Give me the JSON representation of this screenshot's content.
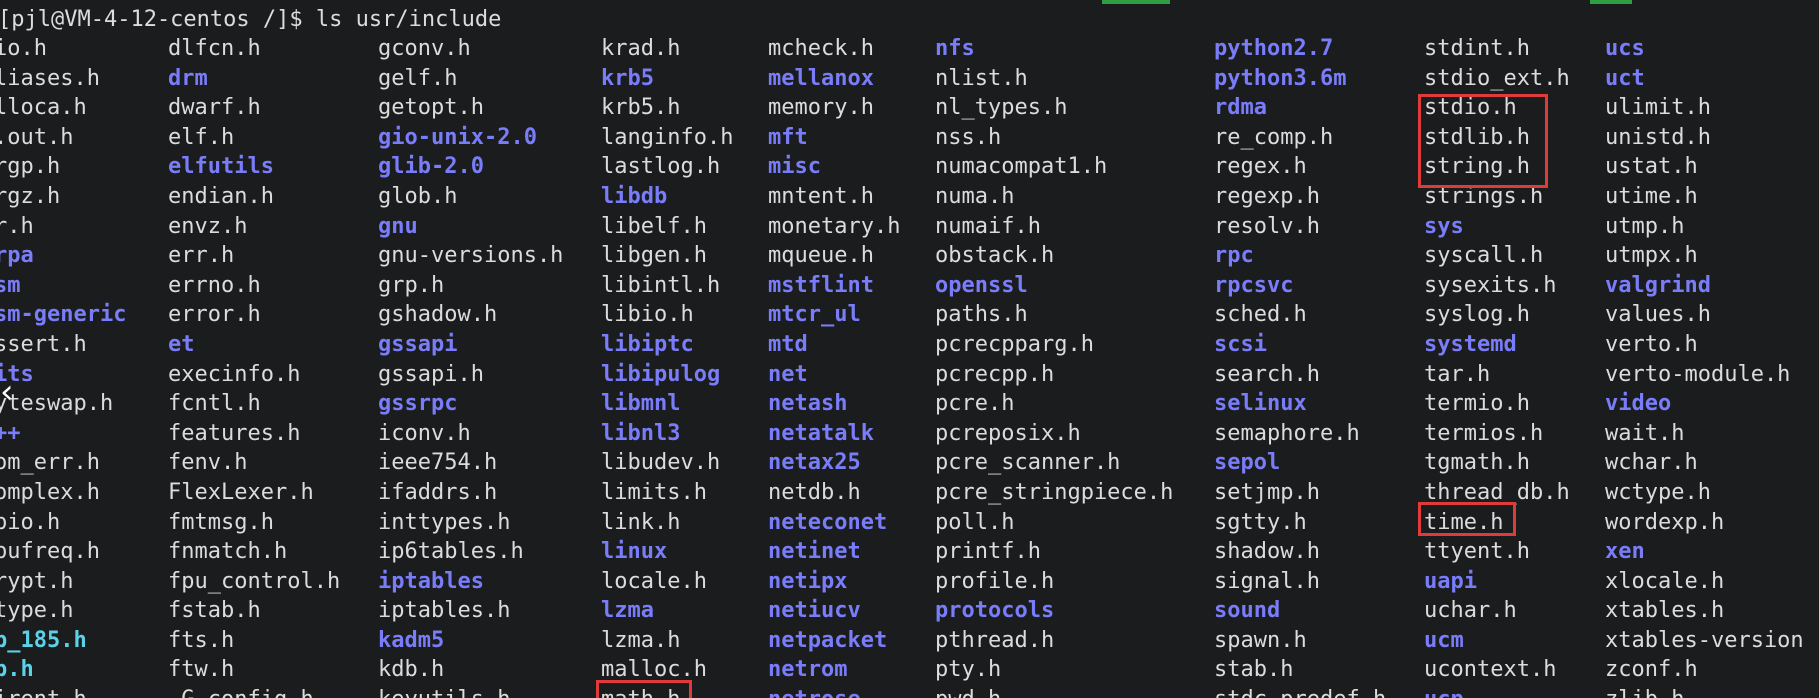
{
  "prompt": "[pjl@VM-4-12-centos /]$ ls usr/include",
  "nav_icon": "chevron-left-icon",
  "highlight_color": "#e03b3b",
  "columns": [
    {
      "entries": [
        {
          "name": "io.h",
          "type": "file"
        },
        {
          "name": "liases.h",
          "type": "file"
        },
        {
          "name": "lloca.h",
          "type": "file"
        },
        {
          "name": ".out.h",
          "type": "file"
        },
        {
          "name": "rgp.h",
          "type": "file"
        },
        {
          "name": "rgz.h",
          "type": "file"
        },
        {
          "name": "r.h",
          "type": "file"
        },
        {
          "name": "rpa",
          "type": "dir"
        },
        {
          "name": "sm",
          "type": "dir"
        },
        {
          "name": "sm-generic",
          "type": "dir"
        },
        {
          "name": "ssert.h",
          "type": "file"
        },
        {
          "name": "its",
          "type": "dir"
        },
        {
          "name": "yteswap.h",
          "type": "file"
        },
        {
          "name": "++",
          "type": "dir"
        },
        {
          "name": "om_err.h",
          "type": "file"
        },
        {
          "name": "omplex.h",
          "type": "file"
        },
        {
          "name": "pio.h",
          "type": "file"
        },
        {
          "name": "pufreq.h",
          "type": "file"
        },
        {
          "name": "rypt.h",
          "type": "file"
        },
        {
          "name": "type.h",
          "type": "file"
        },
        {
          "name": "b_185.h",
          "type": "hl"
        },
        {
          "name": "b.h",
          "type": "hl"
        },
        {
          "name": "irent.h",
          "type": "file"
        }
      ]
    },
    {
      "entries": [
        {
          "name": "dlfcn.h",
          "type": "file"
        },
        {
          "name": "drm",
          "type": "dir"
        },
        {
          "name": "dwarf.h",
          "type": "file"
        },
        {
          "name": "elf.h",
          "type": "file"
        },
        {
          "name": "elfutils",
          "type": "dir"
        },
        {
          "name": "endian.h",
          "type": "file"
        },
        {
          "name": "envz.h",
          "type": "file"
        },
        {
          "name": "err.h",
          "type": "file"
        },
        {
          "name": "errno.h",
          "type": "file"
        },
        {
          "name": "error.h",
          "type": "file"
        },
        {
          "name": "et",
          "type": "dir"
        },
        {
          "name": "execinfo.h",
          "type": "file"
        },
        {
          "name": "fcntl.h",
          "type": "file"
        },
        {
          "name": "features.h",
          "type": "file"
        },
        {
          "name": "fenv.h",
          "type": "file"
        },
        {
          "name": "FlexLexer.h",
          "type": "file"
        },
        {
          "name": "fmtmsg.h",
          "type": "file"
        },
        {
          "name": "fnmatch.h",
          "type": "file"
        },
        {
          "name": "fpu_control.h",
          "type": "file"
        },
        {
          "name": "fstab.h",
          "type": "file"
        },
        {
          "name": "fts.h",
          "type": "file"
        },
        {
          "name": "ftw.h",
          "type": "file"
        },
        {
          "name": "_G_config.h",
          "type": "file"
        }
      ]
    },
    {
      "entries": [
        {
          "name": "gconv.h",
          "type": "file"
        },
        {
          "name": "gelf.h",
          "type": "file"
        },
        {
          "name": "getopt.h",
          "type": "file"
        },
        {
          "name": "gio-unix-2.0",
          "type": "dir"
        },
        {
          "name": "glib-2.0",
          "type": "dir"
        },
        {
          "name": "glob.h",
          "type": "file"
        },
        {
          "name": "gnu",
          "type": "dir"
        },
        {
          "name": "gnu-versions.h",
          "type": "file"
        },
        {
          "name": "grp.h",
          "type": "file"
        },
        {
          "name": "gshadow.h",
          "type": "file"
        },
        {
          "name": "gssapi",
          "type": "dir"
        },
        {
          "name": "gssapi.h",
          "type": "file"
        },
        {
          "name": "gssrpc",
          "type": "dir"
        },
        {
          "name": "iconv.h",
          "type": "file"
        },
        {
          "name": "ieee754.h",
          "type": "file"
        },
        {
          "name": "ifaddrs.h",
          "type": "file"
        },
        {
          "name": "inttypes.h",
          "type": "file"
        },
        {
          "name": "ip6tables.h",
          "type": "file"
        },
        {
          "name": "iptables",
          "type": "dir"
        },
        {
          "name": "iptables.h",
          "type": "file"
        },
        {
          "name": "kadm5",
          "type": "dir"
        },
        {
          "name": "kdb.h",
          "type": "file"
        },
        {
          "name": "keyutils.h",
          "type": "file"
        }
      ]
    },
    {
      "entries": [
        {
          "name": "krad.h",
          "type": "file"
        },
        {
          "name": "krb5",
          "type": "dir"
        },
        {
          "name": "krb5.h",
          "type": "file"
        },
        {
          "name": "langinfo.h",
          "type": "file"
        },
        {
          "name": "lastlog.h",
          "type": "file"
        },
        {
          "name": "libdb",
          "type": "dir"
        },
        {
          "name": "libelf.h",
          "type": "file"
        },
        {
          "name": "libgen.h",
          "type": "file"
        },
        {
          "name": "libintl.h",
          "type": "file"
        },
        {
          "name": "libio.h",
          "type": "file"
        },
        {
          "name": "libiptc",
          "type": "dir"
        },
        {
          "name": "libipulog",
          "type": "dir"
        },
        {
          "name": "libmnl",
          "type": "dir"
        },
        {
          "name": "libnl3",
          "type": "dir"
        },
        {
          "name": "libudev.h",
          "type": "file"
        },
        {
          "name": "limits.h",
          "type": "file"
        },
        {
          "name": "link.h",
          "type": "file"
        },
        {
          "name": "linux",
          "type": "dir"
        },
        {
          "name": "locale.h",
          "type": "file"
        },
        {
          "name": "lzma",
          "type": "dir"
        },
        {
          "name": "lzma.h",
          "type": "file"
        },
        {
          "name": "malloc.h",
          "type": "file"
        },
        {
          "name": "math.h",
          "type": "file"
        }
      ]
    },
    {
      "entries": [
        {
          "name": "mcheck.h",
          "type": "file"
        },
        {
          "name": "mellanox",
          "type": "dir"
        },
        {
          "name": "memory.h",
          "type": "file"
        },
        {
          "name": "mft",
          "type": "dir"
        },
        {
          "name": "misc",
          "type": "dir"
        },
        {
          "name": "mntent.h",
          "type": "file"
        },
        {
          "name": "monetary.h",
          "type": "file"
        },
        {
          "name": "mqueue.h",
          "type": "file"
        },
        {
          "name": "mstflint",
          "type": "dir"
        },
        {
          "name": "mtcr_ul",
          "type": "dir"
        },
        {
          "name": "mtd",
          "type": "dir"
        },
        {
          "name": "net",
          "type": "dir"
        },
        {
          "name": "netash",
          "type": "dir"
        },
        {
          "name": "netatalk",
          "type": "dir"
        },
        {
          "name": "netax25",
          "type": "dir"
        },
        {
          "name": "netdb.h",
          "type": "file"
        },
        {
          "name": "neteconet",
          "type": "dir"
        },
        {
          "name": "netinet",
          "type": "dir"
        },
        {
          "name": "netipx",
          "type": "dir"
        },
        {
          "name": "netiucv",
          "type": "dir"
        },
        {
          "name": "netpacket",
          "type": "dir"
        },
        {
          "name": "netrom",
          "type": "dir"
        },
        {
          "name": "netrose",
          "type": "dir"
        }
      ]
    },
    {
      "entries": [
        {
          "name": "nfs",
          "type": "dir"
        },
        {
          "name": "nlist.h",
          "type": "file"
        },
        {
          "name": "nl_types.h",
          "type": "file"
        },
        {
          "name": "nss.h",
          "type": "file"
        },
        {
          "name": "numacompat1.h",
          "type": "file"
        },
        {
          "name": "numa.h",
          "type": "file"
        },
        {
          "name": "numaif.h",
          "type": "file"
        },
        {
          "name": "obstack.h",
          "type": "file"
        },
        {
          "name": "openssl",
          "type": "dir"
        },
        {
          "name": "paths.h",
          "type": "file"
        },
        {
          "name": "pcrecpparg.h",
          "type": "file"
        },
        {
          "name": "pcrecpp.h",
          "type": "file"
        },
        {
          "name": "pcre.h",
          "type": "file"
        },
        {
          "name": "pcreposix.h",
          "type": "file"
        },
        {
          "name": "pcre_scanner.h",
          "type": "file"
        },
        {
          "name": "pcre_stringpiece.h",
          "type": "file"
        },
        {
          "name": "poll.h",
          "type": "file"
        },
        {
          "name": "printf.h",
          "type": "file"
        },
        {
          "name": "profile.h",
          "type": "file"
        },
        {
          "name": "protocols",
          "type": "dir"
        },
        {
          "name": "pthread.h",
          "type": "file"
        },
        {
          "name": "pty.h",
          "type": "file"
        },
        {
          "name": "pwd.h",
          "type": "file"
        }
      ]
    },
    {
      "entries": [
        {
          "name": "python2.7",
          "type": "dir"
        },
        {
          "name": "python3.6m",
          "type": "dir"
        },
        {
          "name": "rdma",
          "type": "dir"
        },
        {
          "name": "re_comp.h",
          "type": "file"
        },
        {
          "name": "regex.h",
          "type": "file"
        },
        {
          "name": "regexp.h",
          "type": "file"
        },
        {
          "name": "resolv.h",
          "type": "file"
        },
        {
          "name": "rpc",
          "type": "dir"
        },
        {
          "name": "rpcsvc",
          "type": "dir"
        },
        {
          "name": "sched.h",
          "type": "file"
        },
        {
          "name": "scsi",
          "type": "dir"
        },
        {
          "name": "search.h",
          "type": "file"
        },
        {
          "name": "selinux",
          "type": "dir"
        },
        {
          "name": "semaphore.h",
          "type": "file"
        },
        {
          "name": "sepol",
          "type": "dir"
        },
        {
          "name": "setjmp.h",
          "type": "file"
        },
        {
          "name": "sgtty.h",
          "type": "file"
        },
        {
          "name": "shadow.h",
          "type": "file"
        },
        {
          "name": "signal.h",
          "type": "file"
        },
        {
          "name": "sound",
          "type": "dir"
        },
        {
          "name": "spawn.h",
          "type": "file"
        },
        {
          "name": "stab.h",
          "type": "file"
        },
        {
          "name": "stdc-predef.h",
          "type": "file"
        }
      ]
    },
    {
      "entries": [
        {
          "name": "stdint.h",
          "type": "file"
        },
        {
          "name": "stdio_ext.h",
          "type": "file"
        },
        {
          "name": "stdio.h",
          "type": "file"
        },
        {
          "name": "stdlib.h",
          "type": "file"
        },
        {
          "name": "string.h",
          "type": "file"
        },
        {
          "name": "strings.h",
          "type": "file"
        },
        {
          "name": "sys",
          "type": "dir"
        },
        {
          "name": "syscall.h",
          "type": "file"
        },
        {
          "name": "sysexits.h",
          "type": "file"
        },
        {
          "name": "syslog.h",
          "type": "file"
        },
        {
          "name": "systemd",
          "type": "dir"
        },
        {
          "name": "tar.h",
          "type": "file"
        },
        {
          "name": "termio.h",
          "type": "file"
        },
        {
          "name": "termios.h",
          "type": "file"
        },
        {
          "name": "tgmath.h",
          "type": "file"
        },
        {
          "name": "thread_db.h",
          "type": "file"
        },
        {
          "name": "time.h",
          "type": "file"
        },
        {
          "name": "ttyent.h",
          "type": "file"
        },
        {
          "name": "uapi",
          "type": "dir"
        },
        {
          "name": "uchar.h",
          "type": "file"
        },
        {
          "name": "ucm",
          "type": "dir"
        },
        {
          "name": "ucontext.h",
          "type": "file"
        },
        {
          "name": "ucp",
          "type": "dir"
        }
      ]
    },
    {
      "entries": [
        {
          "name": "ucs",
          "type": "dir"
        },
        {
          "name": "uct",
          "type": "dir"
        },
        {
          "name": "ulimit.h",
          "type": "file"
        },
        {
          "name": "unistd.h",
          "type": "file"
        },
        {
          "name": "ustat.h",
          "type": "file"
        },
        {
          "name": "utime.h",
          "type": "file"
        },
        {
          "name": "utmp.h",
          "type": "file"
        },
        {
          "name": "utmpx.h",
          "type": "file"
        },
        {
          "name": "valgrind",
          "type": "dir"
        },
        {
          "name": "values.h",
          "type": "file"
        },
        {
          "name": "verto.h",
          "type": "file"
        },
        {
          "name": "verto-module.h",
          "type": "file"
        },
        {
          "name": "video",
          "type": "dir"
        },
        {
          "name": "wait.h",
          "type": "file"
        },
        {
          "name": "wchar.h",
          "type": "file"
        },
        {
          "name": "wctype.h",
          "type": "file"
        },
        {
          "name": "wordexp.h",
          "type": "file"
        },
        {
          "name": "xen",
          "type": "dir"
        },
        {
          "name": "xlocale.h",
          "type": "file"
        },
        {
          "name": "xtables.h",
          "type": "file"
        },
        {
          "name": "xtables-version",
          "type": "file"
        },
        {
          "name": "zconf.h",
          "type": "file"
        },
        {
          "name": "zlib.h",
          "type": "file"
        }
      ]
    }
  ]
}
